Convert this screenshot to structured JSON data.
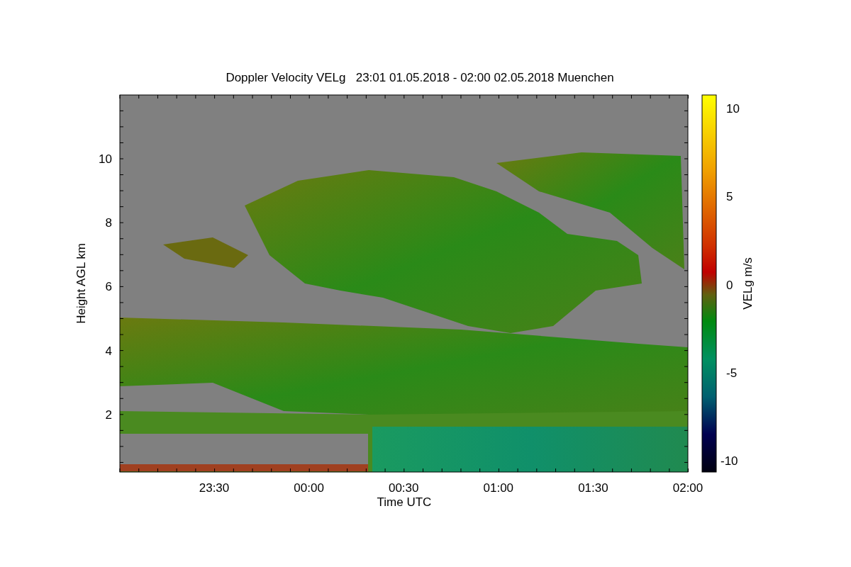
{
  "title": "Doppler Velocity VELg   23:01 01.05.2018 - 02:00 02.05.2018 Muenchen",
  "y_axis": {
    "label": "Height AGL km",
    "ticks": [
      "10",
      "8",
      "6",
      "4",
      "2"
    ]
  },
  "x_axis": {
    "label": "Time UTC",
    "ticks": [
      "23:30",
      "00:00",
      "00:30",
      "01:00",
      "01:30",
      "02:00"
    ]
  },
  "colorbar": {
    "label": "VELg m/s",
    "ticks": [
      "10",
      "5",
      "0",
      "-5",
      "-10"
    ]
  }
}
